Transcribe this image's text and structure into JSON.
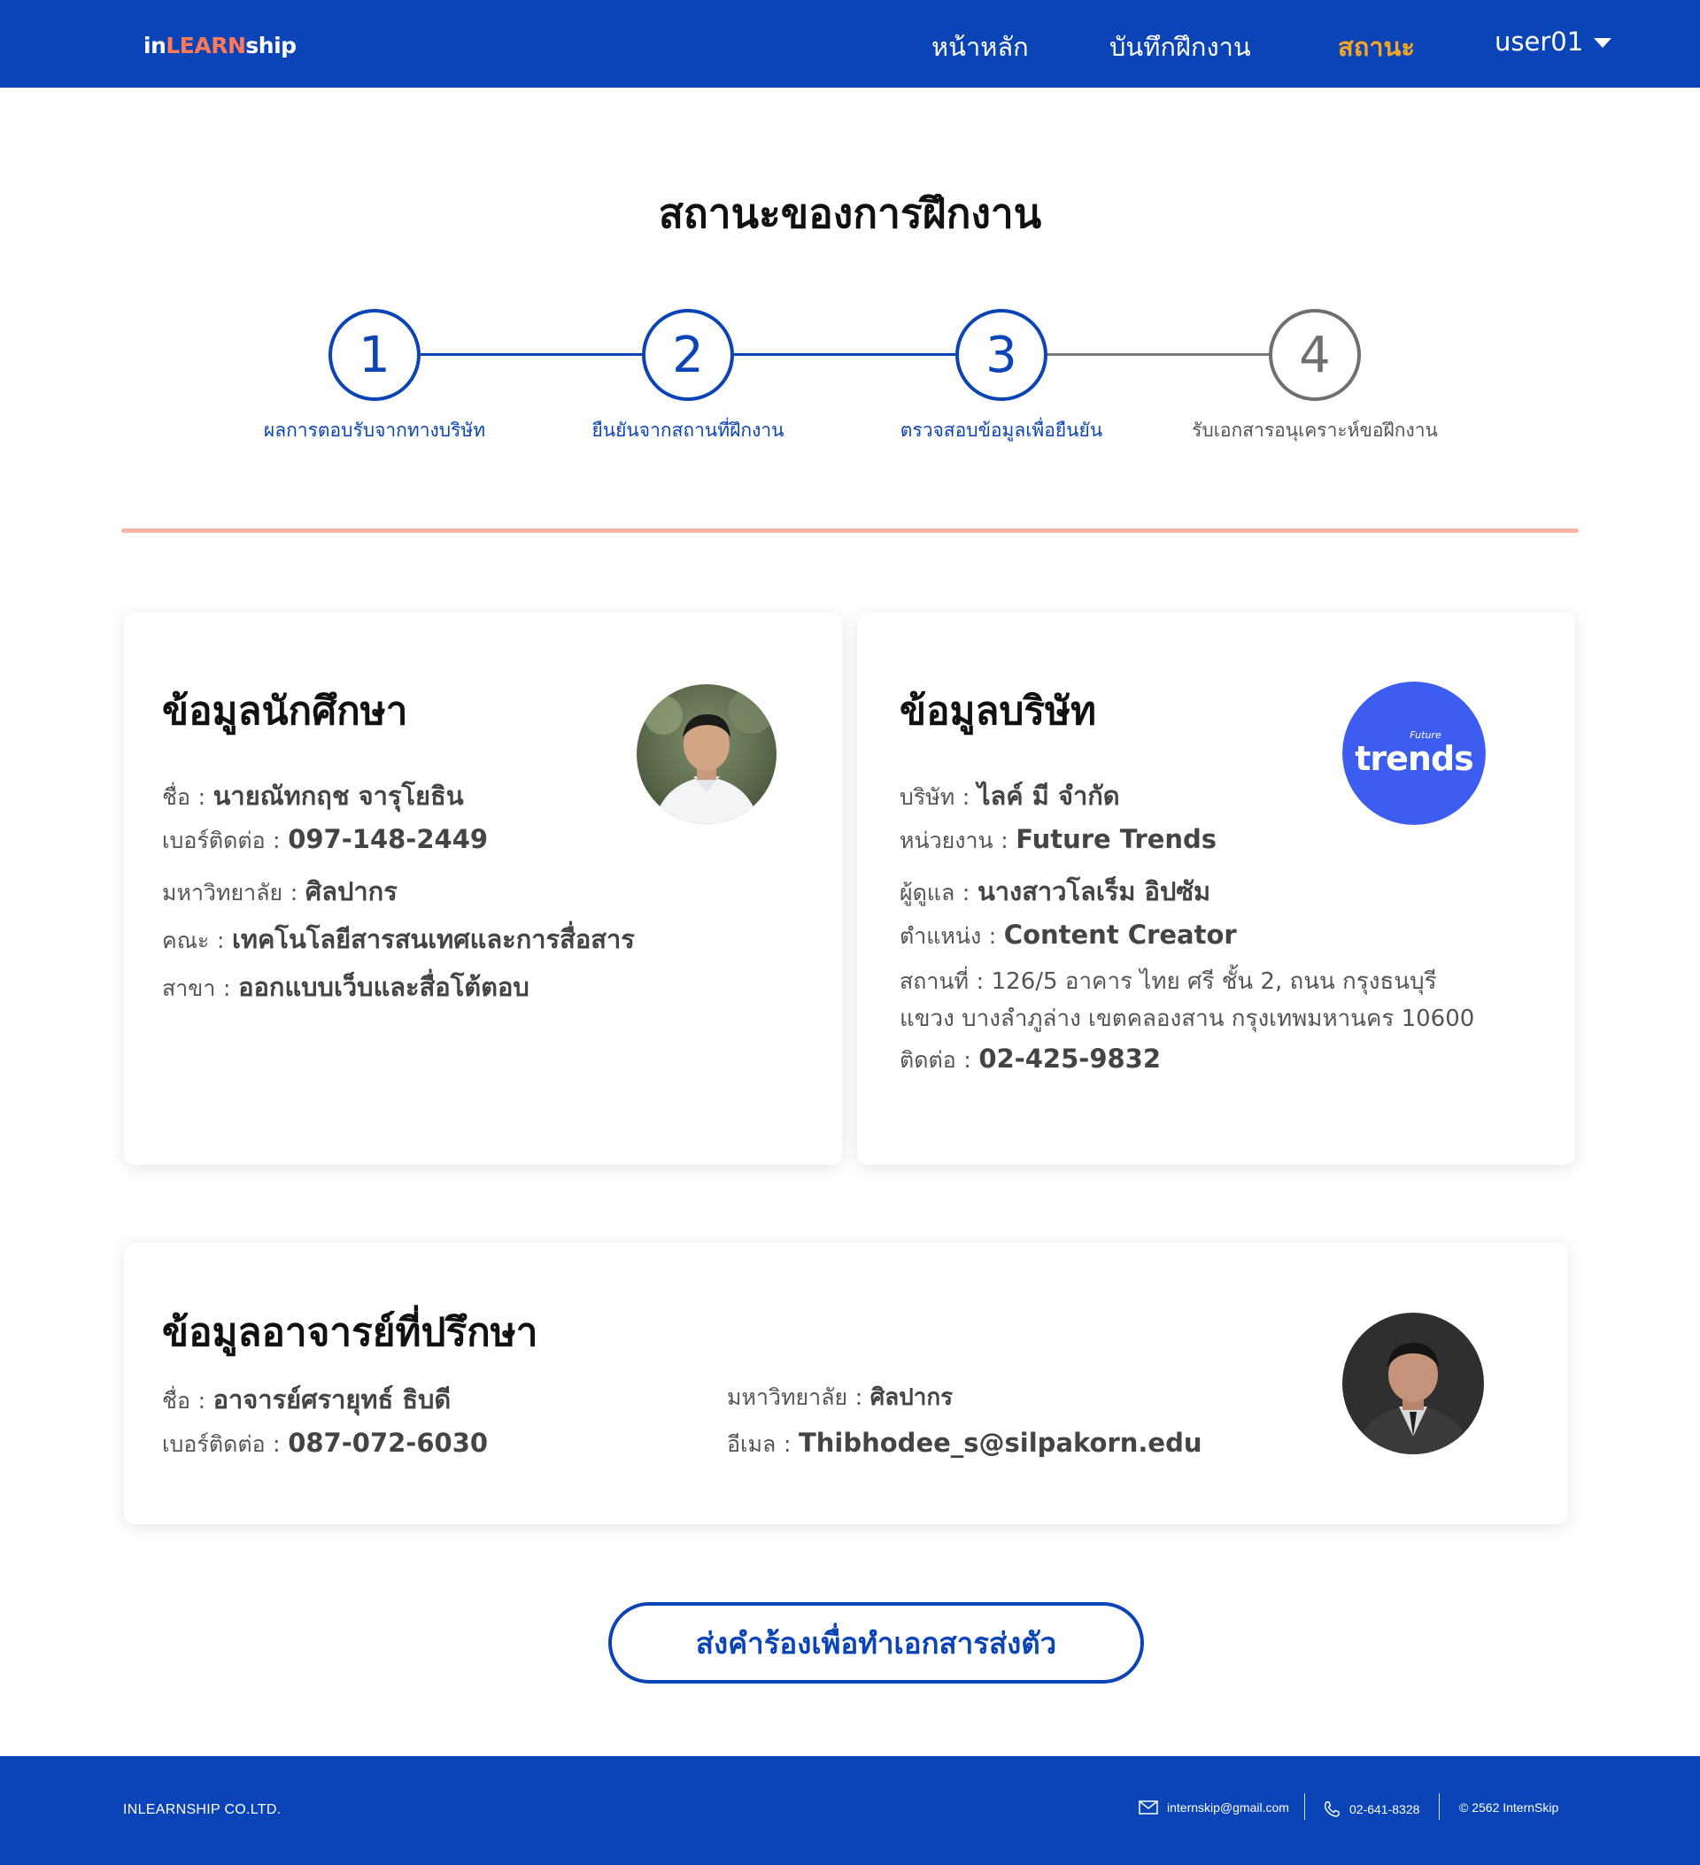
{
  "header": {
    "logo_prefix": "in",
    "logo_middle": "LEARN",
    "logo_suffix": "ship",
    "nav": {
      "home": "หน้าหลัก",
      "log": "บันทึกฝึกงาน",
      "status": "สถานะ",
      "user": "user01"
    },
    "colors": {
      "bar": "#0b44b6",
      "active": "#f5a623",
      "logo_accent": "#ff7a59"
    }
  },
  "page": {
    "title": "สถานะของการฝึกงาน"
  },
  "steps": [
    {
      "number": "1",
      "label": "ผลการตอบรับจากทางบริษัท",
      "state": "done"
    },
    {
      "number": "2",
      "label": "ยืนยันจากสถานที่ฝึกงาน",
      "state": "done"
    },
    {
      "number": "3",
      "label": "ตรวจสอบข้อมูลเพื่อยืนยัน",
      "state": "done"
    },
    {
      "number": "4",
      "label": "รับเอกสารอนุเคราะห์ขอฝึกงาน",
      "state": "todo"
    }
  ],
  "student": {
    "title": "ข้อมูลนักศึกษา",
    "separator": ":",
    "name_label": "ชื่อ",
    "name": "นายณัทกฤช จารุโยธิน",
    "phone_label": "เบอร์ติดต่อ",
    "phone": "097-148-2449",
    "university_label": "มหาวิทยาลัย",
    "university": "ศิลปากร",
    "faculty_label": "คณะ",
    "faculty": "เทคโนโลยีสารสนเทศและการสื่อสาร",
    "major_label": "สาขา",
    "major": "ออกแบบเว็บและสื่อโต้ตอบ"
  },
  "company": {
    "title": "ข้อมูลบริษัท",
    "logo_small": "Future",
    "logo_big": "trends",
    "logo_color": "#3d5df0",
    "company_label": "บริษัท",
    "company": "ไลค์ มี จำกัด",
    "unit_label": "หน่วยงาน",
    "unit": "Future Trends",
    "supervisor_label": "ผู้ดูแล",
    "supervisor": "นางสาวโลเร็ม อิปซัม",
    "position_label": "ตำแหน่ง",
    "position": "Content Creator",
    "address_label": "สถานที่",
    "address_line1": "126/5 อาคาร ไทย ศรี ชั้น 2, ถนน กรุงธนบุรี",
    "address_line2": "แขวง บางลำภูล่าง เขตคลองสาน กรุงเทพมหานคร 10600",
    "contact_label": "ติดต่อ",
    "contact": "02-425-9832"
  },
  "advisor": {
    "title": "ข้อมูลอาจารย์ที่ปรึกษา",
    "name_label": "ชื่อ",
    "name": "อาจารย์ศรายุทธ์ ธิบดี",
    "phone_label": "เบอร์ติดต่อ",
    "phone": "087-072-6030",
    "university_label": "มหาวิทยาลัย",
    "university": "ศิลปากร",
    "email_label": "อีเมล",
    "email": "Thibhodee_s@silpakorn.edu"
  },
  "cta": {
    "label": "ส่งคำร้องเพื่อทำเอกสารส่งตัว"
  },
  "footer": {
    "brand": "INLEARNSHIP CO.LTD.",
    "email": "internskip@gmail.com",
    "phone": "02-641-8328",
    "copyright": "© 2562 InternSkip"
  }
}
